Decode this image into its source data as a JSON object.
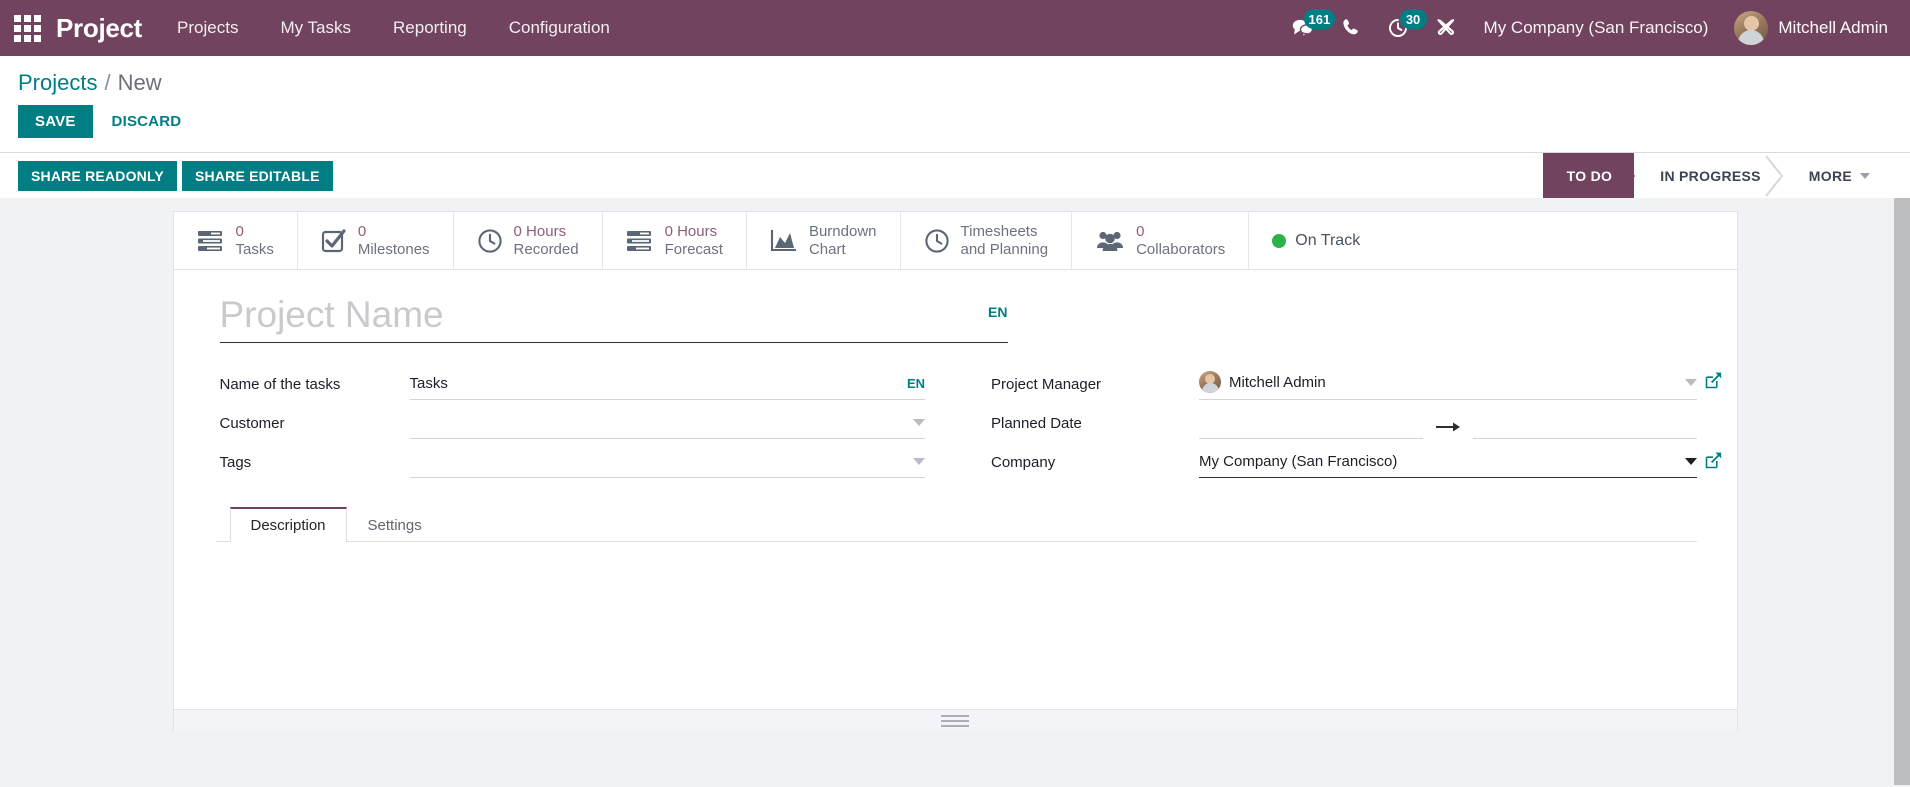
{
  "navbar": {
    "apps_icon": "apps-grid-icon",
    "brand": "Project",
    "menu": [
      {
        "label": "Projects"
      },
      {
        "label": "My Tasks"
      },
      {
        "label": "Reporting"
      },
      {
        "label": "Configuration"
      }
    ],
    "messages_icon": "messages-icon",
    "messages_count": "161",
    "phone_icon": "phone-icon",
    "activity_icon": "activity-clock-icon",
    "activity_count": "30",
    "debug_icon": "debug-tools-icon",
    "company": "My Company (San Francisco)",
    "user": "Mitchell Admin",
    "accent_color": "#71435f",
    "badge_color": "#017e84"
  },
  "control_panel": {
    "breadcrumb_root": "Projects",
    "breadcrumb_sep": "/",
    "breadcrumb_current": "New",
    "save_label": "SAVE",
    "discard_label": "DISCARD"
  },
  "sub_bar": {
    "share_readonly_label": "SHARE READONLY",
    "share_editable_label": "SHARE EDITABLE",
    "status_steps": [
      {
        "label": "TO DO",
        "active": true
      },
      {
        "label": "IN PROGRESS",
        "active": false
      },
      {
        "label": "MORE",
        "active": false,
        "has_caret": true
      }
    ]
  },
  "stat_buttons": [
    {
      "icon": "tasks-list-icon",
      "value": "0",
      "label": "Tasks"
    },
    {
      "icon": "milestone-check-icon",
      "value": "0",
      "label": "Milestones"
    },
    {
      "icon": "clock-icon",
      "value": "0 Hours",
      "label": "Recorded"
    },
    {
      "icon": "forecast-list-icon",
      "value": "0 Hours",
      "label": "Forecast"
    },
    {
      "icon": "burndown-chart-icon",
      "value": "Burndown",
      "label": "Chart"
    },
    {
      "icon": "timesheets-clock-icon",
      "value": "Timesheets",
      "label": "and Planning"
    },
    {
      "icon": "collaborators-users-icon",
      "value": "0",
      "label": "Collaborators"
    }
  ],
  "project_status": {
    "indicator": "green-dot-icon",
    "label": "On Track",
    "color": "#2bb34a"
  },
  "form": {
    "title_value": "",
    "title_placeholder": "Project Name",
    "title_lang_badge": "EN",
    "left": {
      "task_name_label": "Name of the tasks",
      "task_name_value": "Tasks",
      "task_name_lang_badge": "EN",
      "customer_label": "Customer",
      "customer_value": "",
      "tags_label": "Tags",
      "tags_value": ""
    },
    "right": {
      "manager_label": "Project Manager",
      "manager_value": "Mitchell Admin",
      "planned_date_label": "Planned Date",
      "planned_date_start": "",
      "planned_date_end": "",
      "company_label": "Company",
      "company_value": "My Company (San Francisco)"
    }
  },
  "notebook": {
    "tabs": [
      {
        "label": "Description",
        "active": true
      },
      {
        "label": "Settings",
        "active": false
      }
    ],
    "body_text": ""
  }
}
